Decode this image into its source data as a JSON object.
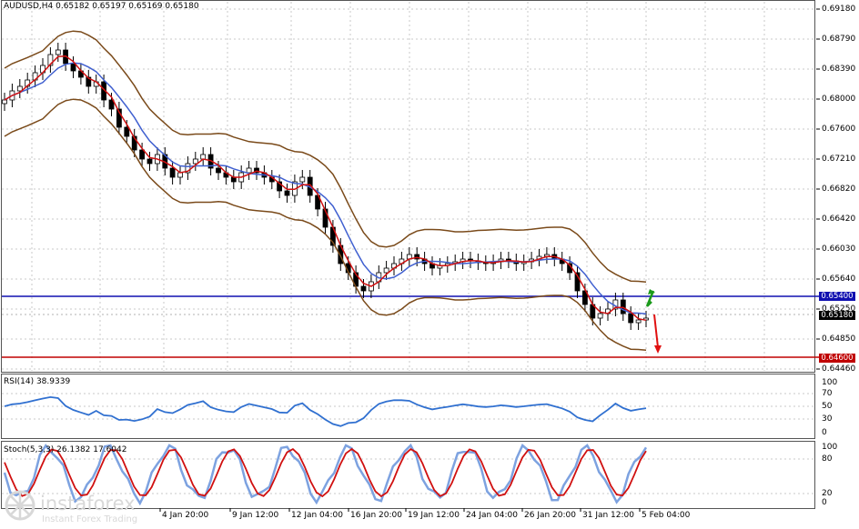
{
  "main": {
    "header": "AUDUSD,H4  0.65182 0.65197 0.65169 0.65180",
    "price_levels": [
      "0.69180",
      "0.68790",
      "0.68390",
      "0.68000",
      "0.67600",
      "0.67210",
      "0.66820",
      "0.66420",
      "0.66030",
      "0.65640",
      "0.65250",
      "0.64850",
      "0.64460"
    ],
    "level_blue": "0.65400",
    "level_last": "0.65180",
    "level_red": "0.64600",
    "colors": {
      "blue_line": "#1010b0",
      "red_line": "#c00000",
      "last_tag": "#000000",
      "up_arrow": "#1a9a1a",
      "down_arrow": "#e01010",
      "bands": "#7a4a1a",
      "ma_fast": "#d01010",
      "ma_slow": "#4060d0"
    }
  },
  "rsi": {
    "title": "RSI(14) 38.9339",
    "levels": [
      "100",
      "70",
      "50",
      "30",
      "0"
    ]
  },
  "stoch": {
    "title": "Stoch(5,3,3) 26.1382 17.6042",
    "levels": [
      "100",
      "80",
      "20",
      "0"
    ]
  },
  "xaxis": {
    "labels": [
      "4 Jan 20:00",
      "9 Jan 12:00",
      "12 Jan 04:00",
      "16 Jan 20:00",
      "19 Jan 12:00",
      "24 Jan 04:00",
      "26 Jan 20:00",
      "31 Jan 12:00",
      "5 Feb 04:00"
    ]
  },
  "watermark": {
    "name": "instaforex",
    "sub": "Instant Forex Trading"
  }
}
